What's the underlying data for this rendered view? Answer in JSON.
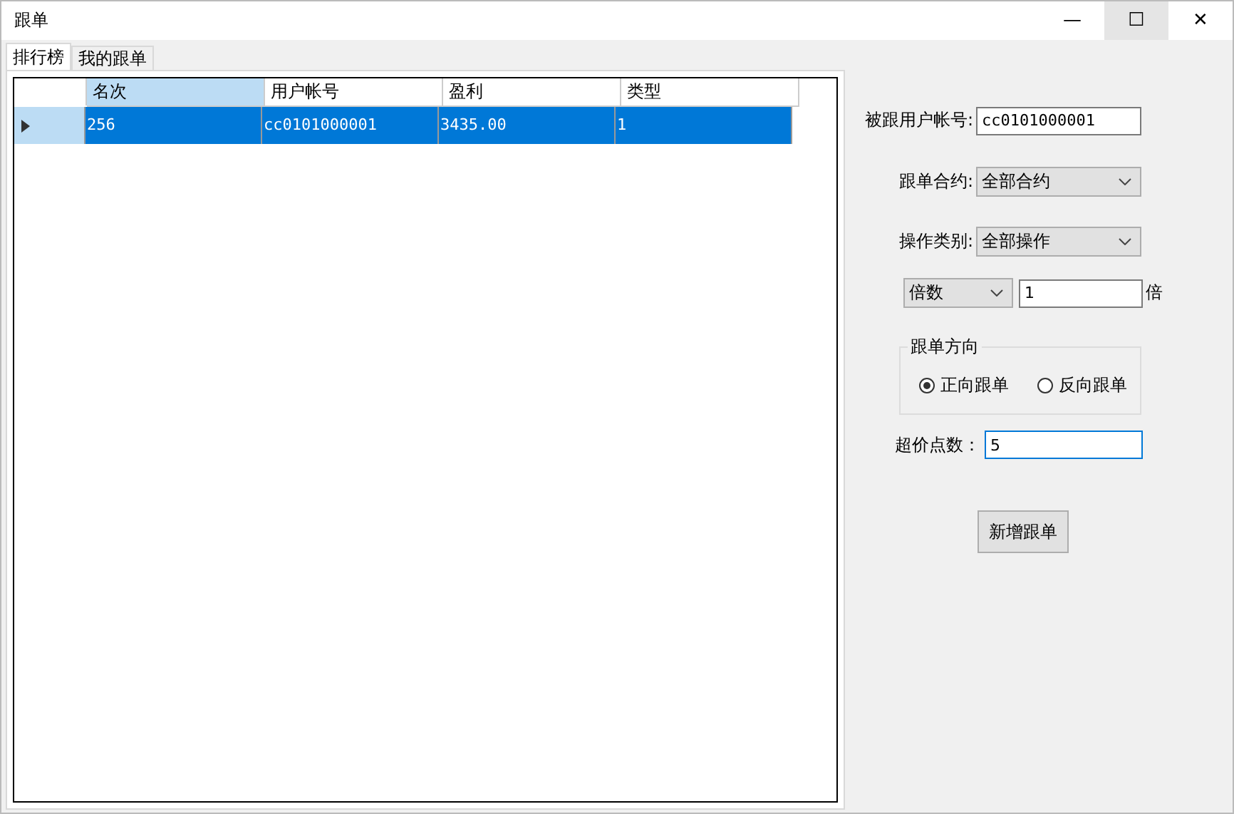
{
  "window": {
    "title": "跟单",
    "controls": [
      {
        "glyph": "—",
        "hovered": false
      },
      {
        "glyph": "☐",
        "hovered": true
      },
      {
        "glyph": "✕",
        "hovered": false
      }
    ]
  },
  "tabs": [
    {
      "label": "排行榜",
      "selected": true
    },
    {
      "label": "我的跟单",
      "selected": false
    }
  ],
  "table": {
    "columns": [
      {
        "label": "名次",
        "selected": true
      },
      {
        "label": "用户帐号",
        "selected": false
      },
      {
        "label": "盈利",
        "selected": false
      },
      {
        "label": "类型",
        "selected": false
      }
    ],
    "rows": [
      {
        "cells": [
          "256",
          "cc0101000001",
          "3435.00",
          "1"
        ],
        "selected": true,
        "current": true
      }
    ]
  },
  "form": {
    "follow_account": {
      "label": "被跟用户帐号:",
      "value": "cc0101000001"
    },
    "contract": {
      "label": "跟单合约:",
      "value": "全部合约"
    },
    "operation": {
      "label": "操作类别:",
      "value": "全部操作"
    },
    "multiplier": {
      "mode": "倍数",
      "value": "1",
      "unit": "倍"
    },
    "direction": {
      "title": "跟单方向",
      "options": [
        {
          "label": "正向跟单",
          "selected": true
        },
        {
          "label": "反向跟单",
          "selected": false
        }
      ]
    },
    "slippage": {
      "label": "超价点数：",
      "value": "5",
      "focused": true
    },
    "button": "新增跟单"
  }
}
